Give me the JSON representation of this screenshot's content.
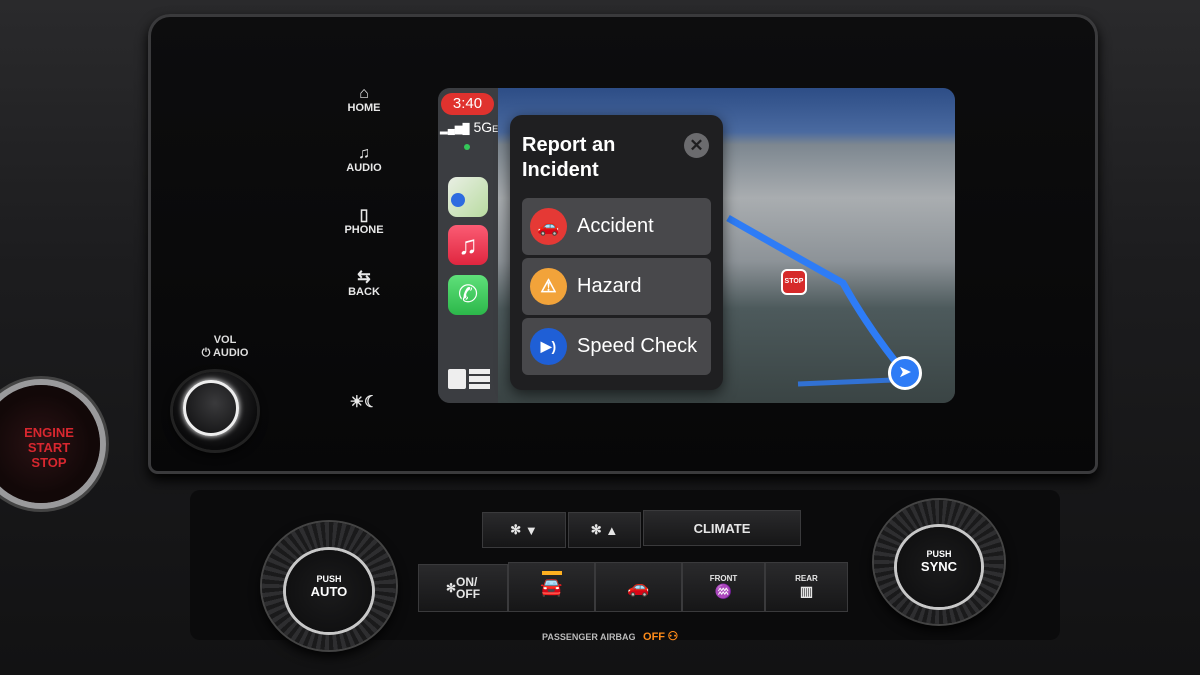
{
  "head_unit": {
    "buttons": [
      {
        "label": "HOME",
        "icon": "home-icon"
      },
      {
        "label": "AUDIO",
        "icon": "music-note-icon"
      },
      {
        "label": "PHONE",
        "icon": "phone-handset-icon"
      },
      {
        "label": "BACK",
        "icon": "back-arrow-icon"
      }
    ],
    "brightness_icon": "sun-moon-icon",
    "vol_label": "VOL",
    "audio_label": "AUDIO"
  },
  "engine": {
    "line1": "ENGINE",
    "line2": "START",
    "line3": "STOP"
  },
  "carplay": {
    "time": "3:40",
    "network": "5G",
    "network_suffix": "E",
    "apps": [
      {
        "name": "Maps",
        "icon": "maps-icon"
      },
      {
        "name": "Music",
        "icon": "music-icon"
      },
      {
        "name": "Phone",
        "icon": "phone-icon"
      }
    ],
    "dashboard_icon": "dashboard-icon",
    "map": {
      "sign": "STOP"
    },
    "modal": {
      "title": "Report an Incident",
      "close_icon": "close-icon",
      "items": [
        {
          "label": "Accident",
          "icon": "accident-icon",
          "color": "#e53935"
        },
        {
          "label": "Hazard",
          "icon": "hazard-icon",
          "color": "#f2a33a"
        },
        {
          "label": "Speed Check",
          "icon": "speed-check-icon",
          "color": "#1f5fd6"
        }
      ]
    }
  },
  "climate": {
    "fan_down": "▼",
    "fan_up": "▲",
    "climate_label": "CLIMATE",
    "on_off": "ON/\nOFF",
    "front": "FRONT",
    "rear": "REAR",
    "left_knob": {
      "line1": "PUSH",
      "line2": "AUTO"
    },
    "right_knob": {
      "line1": "PUSH",
      "line2": "SYNC"
    },
    "airbag_label": "PASSENGER AIRBAG",
    "airbag_status": "OFF",
    "airbag_color": "#ff8c1a"
  }
}
